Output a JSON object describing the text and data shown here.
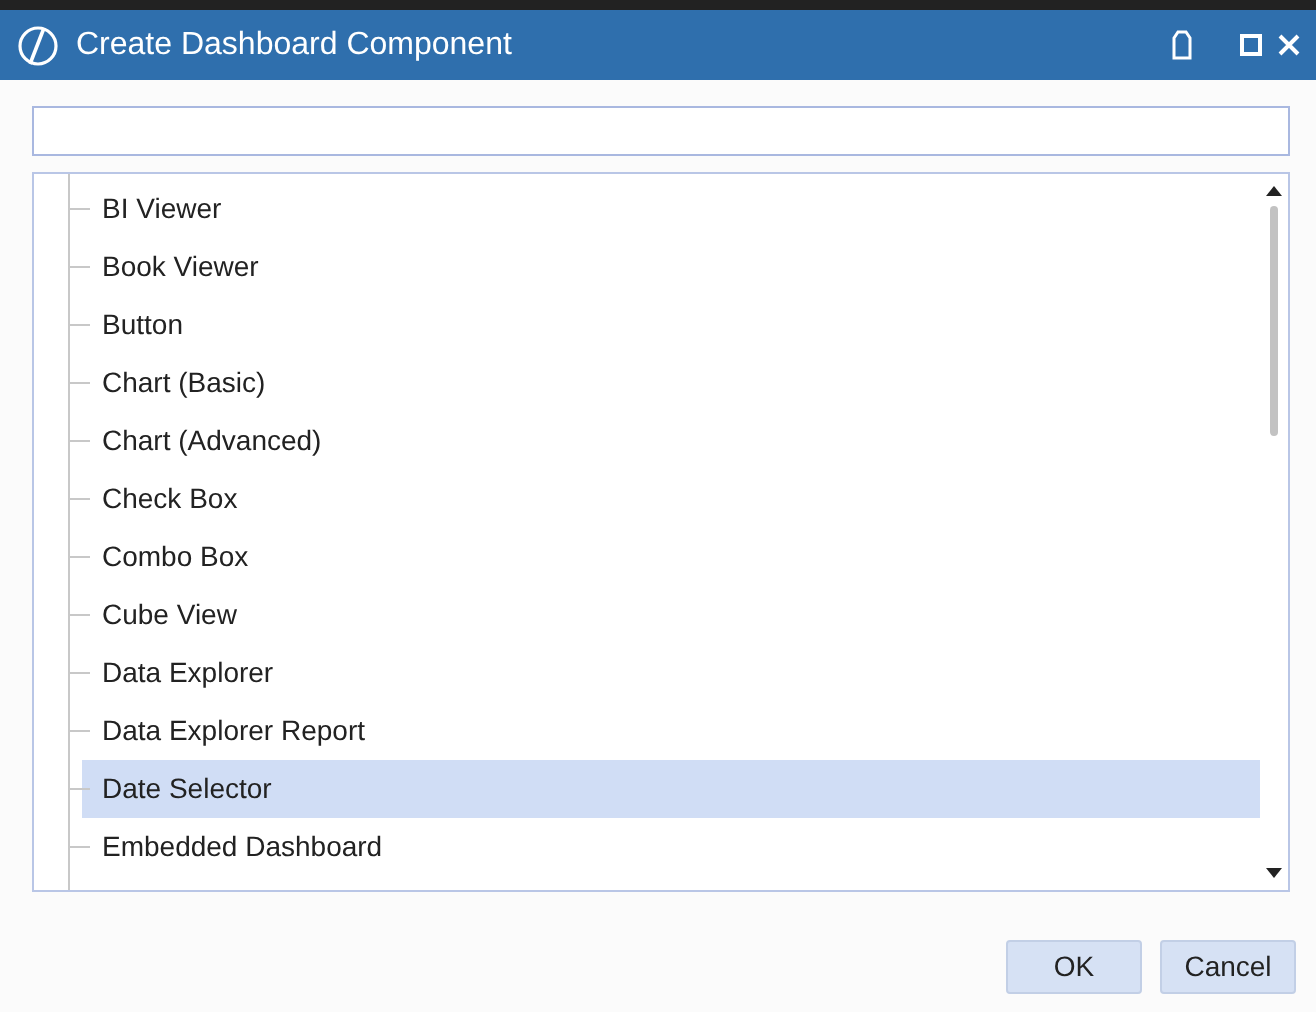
{
  "window": {
    "title": "Create Dashboard Component"
  },
  "items": [
    {
      "label": "BI Viewer",
      "selected": false
    },
    {
      "label": "Book Viewer",
      "selected": false
    },
    {
      "label": "Button",
      "selected": false
    },
    {
      "label": "Chart (Basic)",
      "selected": false
    },
    {
      "label": "Chart (Advanced)",
      "selected": false
    },
    {
      "label": "Check Box",
      "selected": false
    },
    {
      "label": "Combo Box",
      "selected": false
    },
    {
      "label": "Cube View",
      "selected": false
    },
    {
      "label": "Data Explorer",
      "selected": false
    },
    {
      "label": "Data Explorer Report",
      "selected": false
    },
    {
      "label": "Date Selector",
      "selected": true
    },
    {
      "label": "Embedded Dashboard",
      "selected": false
    }
  ],
  "buttons": [
    "OK",
    "Cancel"
  ]
}
